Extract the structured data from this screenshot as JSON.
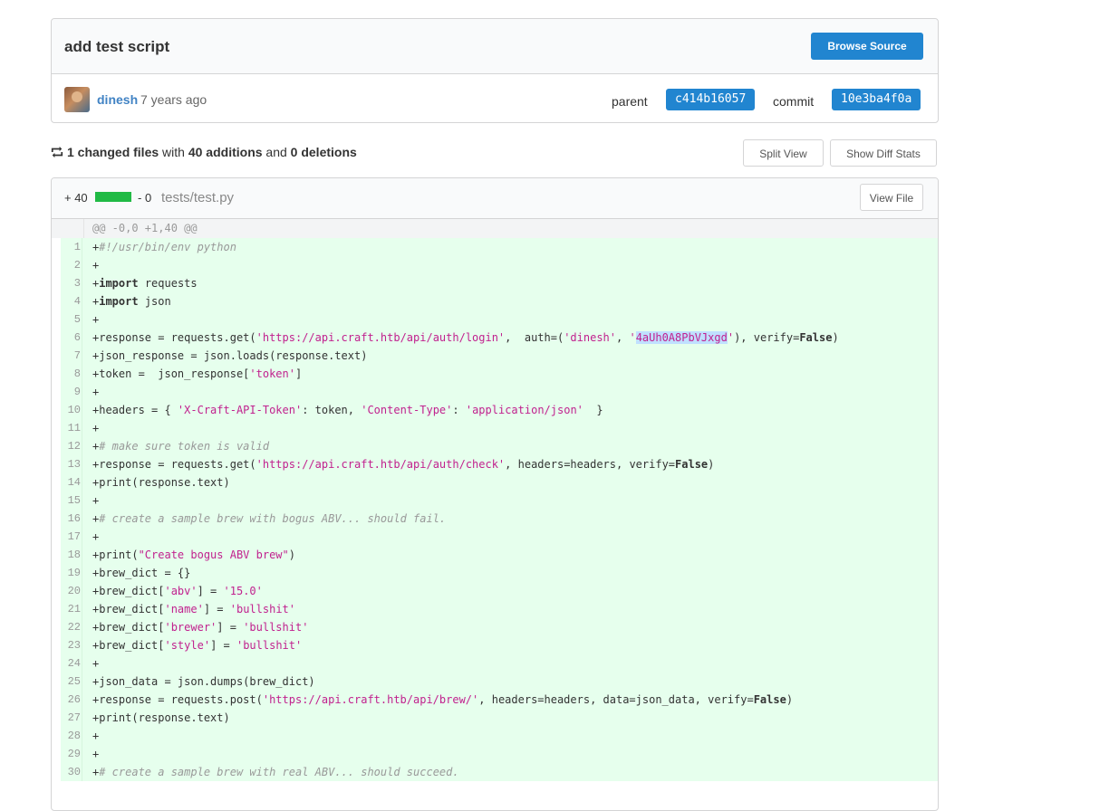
{
  "commit": {
    "title": "add test script",
    "browse_source": "Browse Source",
    "author": "dinesh",
    "time": "7 years ago",
    "parent_label": "parent",
    "parent_sha": "c414b16057",
    "commit_label": "commit",
    "commit_sha": "10e3ba4f0a"
  },
  "stats": {
    "changed": "1 changed files",
    "with": "with",
    "additions": "40 additions",
    "and": "and",
    "deletions": "0 deletions",
    "split_view": "Split View",
    "show_diff_stats": "Show Diff Stats"
  },
  "file": {
    "additions": "+ 40",
    "deletions": "- 0",
    "name": "tests/test.py",
    "view_file": "View File",
    "hunk": "@@ -0,0 +1,40 @@",
    "lines": [
      {
        "n": "1",
        "code": "+#!/usr/bin/env python"
      },
      {
        "n": "2",
        "code": "+"
      },
      {
        "n": "3",
        "code": "+import requests"
      },
      {
        "n": "4",
        "code": "+import json"
      },
      {
        "n": "5",
        "code": "+"
      },
      {
        "n": "6",
        "code": "+response = requests.get('https://api.craft.htb/api/auth/login',  auth=('dinesh', '4aUh0A8PbVJxgd'), verify=False)"
      },
      {
        "n": "7",
        "code": "+json_response = json.loads(response.text)"
      },
      {
        "n": "8",
        "code": "+token =  json_response['token']"
      },
      {
        "n": "9",
        "code": "+"
      },
      {
        "n": "10",
        "code": "+headers = { 'X-Craft-API-Token': token, 'Content-Type': 'application/json'  }"
      },
      {
        "n": "11",
        "code": "+"
      },
      {
        "n": "12",
        "code": "+# make sure token is valid"
      },
      {
        "n": "13",
        "code": "+response = requests.get('https://api.craft.htb/api/auth/check', headers=headers, verify=False)"
      },
      {
        "n": "14",
        "code": "+print(response.text)"
      },
      {
        "n": "15",
        "code": "+"
      },
      {
        "n": "16",
        "code": "+# create a sample brew with bogus ABV... should fail."
      },
      {
        "n": "17",
        "code": "+"
      },
      {
        "n": "18",
        "code": "+print(\"Create bogus ABV brew\")"
      },
      {
        "n": "19",
        "code": "+brew_dict = {}"
      },
      {
        "n": "20",
        "code": "+brew_dict['abv'] = '15.0'"
      },
      {
        "n": "21",
        "code": "+brew_dict['name'] = 'bullshit'"
      },
      {
        "n": "22",
        "code": "+brew_dict['brewer'] = 'bullshit'"
      },
      {
        "n": "23",
        "code": "+brew_dict['style'] = 'bullshit'"
      },
      {
        "n": "24",
        "code": "+"
      },
      {
        "n": "25",
        "code": "+json_data = json.dumps(brew_dict)"
      },
      {
        "n": "26",
        "code": "+response = requests.post('https://api.craft.htb/api/brew/', headers=headers, data=json_data, verify=False)"
      },
      {
        "n": "27",
        "code": "+print(response.text)"
      },
      {
        "n": "28",
        "code": "+"
      },
      {
        "n": "29",
        "code": "+"
      },
      {
        "n": "30",
        "code": "+# create a sample brew with real ABV... should succeed."
      }
    ]
  },
  "colors": {
    "primary": "#2185d0",
    "added_bg": "#e6ffed",
    "add_bar": "#21ba45",
    "string": "#c1218e",
    "link": "#4183c4"
  }
}
